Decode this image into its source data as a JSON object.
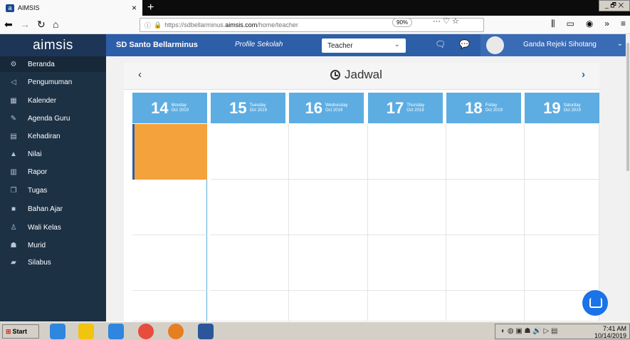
{
  "browser": {
    "tab_title": "AIMSIS",
    "tab_favicon": "a",
    "tab_close": "×",
    "new_tab": "+",
    "url_prefix": "https://sdbellarminus.",
    "url_host": "aimsis.com",
    "url_path": "/home/teacher",
    "zoom": "90%",
    "window_controls": "_ 🗗 ✕"
  },
  "header": {
    "logo": "aimsis",
    "school": "SD Santo Bellarminus",
    "profile_link": "Profile Sekolah",
    "role_value": "Teacher",
    "user_name": "Ganda Rejeki Sihotang"
  },
  "sidebar": {
    "items": [
      {
        "label": "Beranda",
        "icon": "dashboard-icon",
        "glyph": "⚙"
      },
      {
        "label": "Pengumuman",
        "icon": "megaphone-icon",
        "glyph": "◁"
      },
      {
        "label": "Kalender",
        "icon": "calendar-icon",
        "glyph": "▦"
      },
      {
        "label": "Agenda Guru",
        "icon": "pencil-icon",
        "glyph": "✎"
      },
      {
        "label": "Kehadiran",
        "icon": "table-icon",
        "glyph": "▤"
      },
      {
        "label": "Nilai",
        "icon": "graduation-cap-icon",
        "glyph": "▲"
      },
      {
        "label": "Rapor",
        "icon": "bar-chart-icon",
        "glyph": "▥"
      },
      {
        "label": "Tugas",
        "icon": "copy-icon",
        "glyph": "❐"
      },
      {
        "label": "Bahan Ajar",
        "icon": "book-icon",
        "glyph": "■"
      },
      {
        "label": "Wali Kelas",
        "icon": "user-tie-icon",
        "glyph": "♙"
      },
      {
        "label": "Murid",
        "icon": "users-icon",
        "glyph": "☗"
      },
      {
        "label": "Silabus",
        "icon": "book-open-icon",
        "glyph": "▰"
      }
    ]
  },
  "calendar": {
    "title": "Jadwal",
    "prev": "‹",
    "next": "›",
    "days": [
      {
        "num": "14",
        "name": "Monday",
        "month": "Oct 2019"
      },
      {
        "num": "15",
        "name": "Tuesday",
        "month": "Oct 2019"
      },
      {
        "num": "16",
        "name": "Wednesday",
        "month": "Oct 2019"
      },
      {
        "num": "17",
        "name": "Thursday",
        "month": "Oct 2019"
      },
      {
        "num": "18",
        "name": "Friday",
        "month": "Oct 2019"
      },
      {
        "num": "19",
        "name": "Saturday",
        "month": "Oct 2019"
      }
    ],
    "event_color": "#f4a23c"
  },
  "taskbar": {
    "start": "Start",
    "time": "7:41 AM",
    "date": "10/14/2019"
  }
}
